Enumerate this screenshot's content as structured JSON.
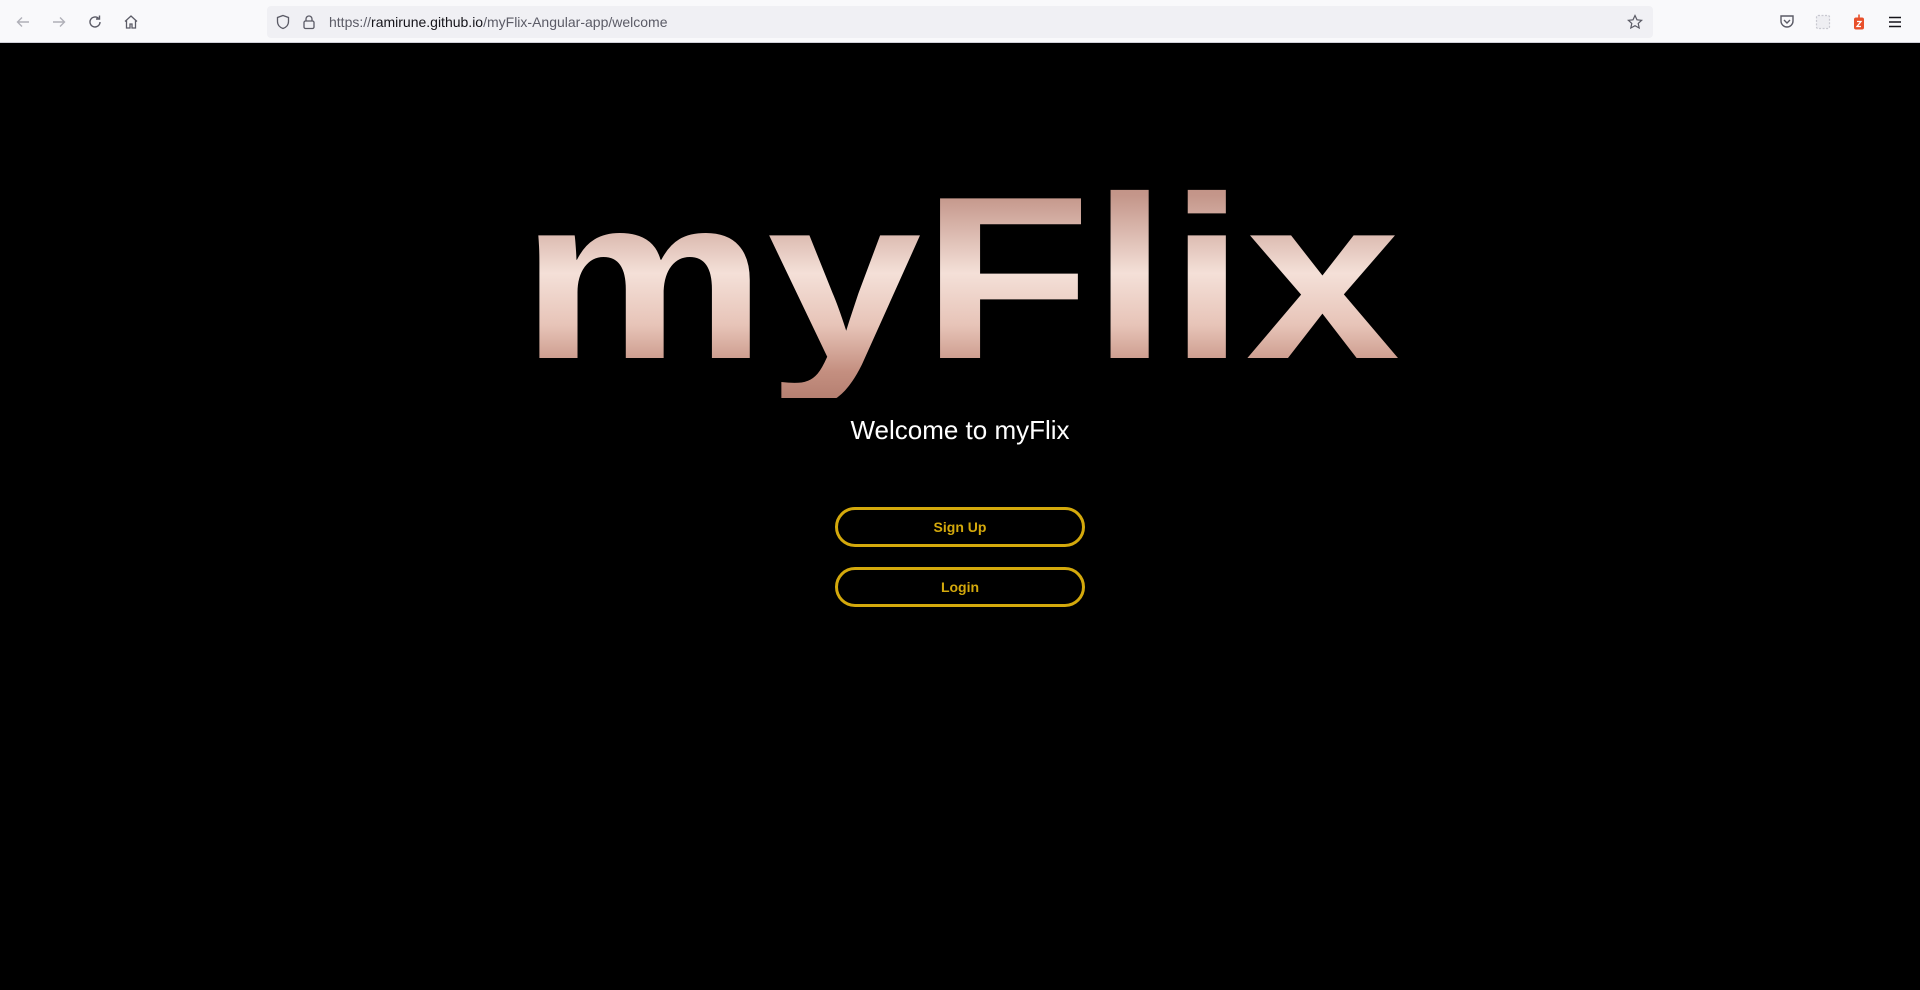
{
  "browser": {
    "url_scheme": "https://",
    "url_host": "ramirune.github.io",
    "url_path": "/myFlix-Angular-app/welcome",
    "icons": [
      "back-icon",
      "forward-icon",
      "reload-icon",
      "home-icon",
      "shield-icon",
      "lock-icon",
      "star-icon",
      "pocket-icon",
      "extension-icon",
      "notification-icon",
      "menu-icon"
    ]
  },
  "page": {
    "logo_text": "myFlix",
    "welcome_text": "Welcome to myFlix",
    "signup_label": "Sign Up",
    "login_label": "Login"
  },
  "colors": {
    "background": "#000000",
    "accent": "#d4a90c",
    "logo_light": "#f3dcd4",
    "logo_dark": "#c48f80"
  }
}
